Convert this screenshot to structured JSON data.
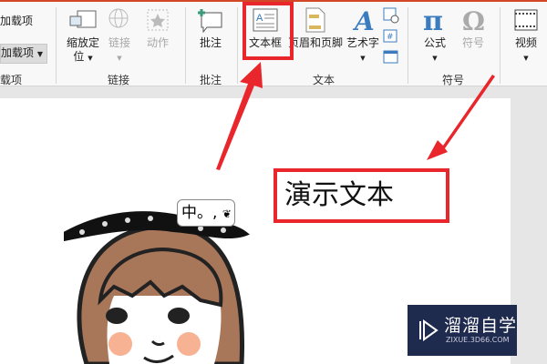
{
  "ribbon": {
    "addins": {
      "item1": "加载项",
      "item2": "加载项",
      "group": "载项"
    },
    "links": {
      "zoom": "缩放定",
      "zoom2": "位",
      "link": "链接",
      "action": "动作",
      "group": "链接"
    },
    "comments": {
      "comment": "批注",
      "group": "批注"
    },
    "text": {
      "textbox": "文本框",
      "header_footer": "页眉和页脚",
      "wordart": "艺术字",
      "group": "文本"
    },
    "symbols": {
      "equation": "公式",
      "symbol": "符号",
      "group": "符号"
    },
    "media": {
      "video": "视频"
    }
  },
  "slide": {
    "textbox_text": "演示文本",
    "ime_indicator": "中。,"
  },
  "watermark": {
    "name": "溜溜自学",
    "url": "ZIXUE.3D66.COM"
  },
  "colors": {
    "accent": "#e8262b",
    "ribbon_top": "#d24726"
  }
}
